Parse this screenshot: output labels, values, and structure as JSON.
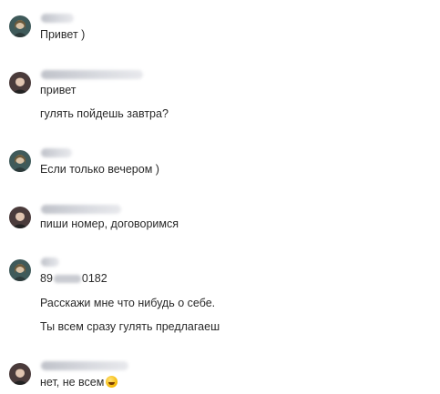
{
  "messages": [
    {
      "author": "female-1",
      "lines": [
        "Привет )"
      ]
    },
    {
      "author": "male-1",
      "lines": [
        "привет",
        "гулять пойдешь завтра?"
      ]
    },
    {
      "author": "female-1",
      "lines": [
        "Если только вечером )"
      ]
    },
    {
      "author": "male-1",
      "lines": [
        "пиши номер, договоримся"
      ]
    },
    {
      "author": "female-1",
      "lines": [
        "Расскажи мне что нибудь о себе.",
        "Ты всем сразу гулять предлагаеш"
      ]
    },
    {
      "author": "male-1",
      "lines": [
        "нет, не всем"
      ]
    }
  ],
  "phone": {
    "start": "89",
    "end": "0182"
  },
  "emoji": "grinning-face"
}
